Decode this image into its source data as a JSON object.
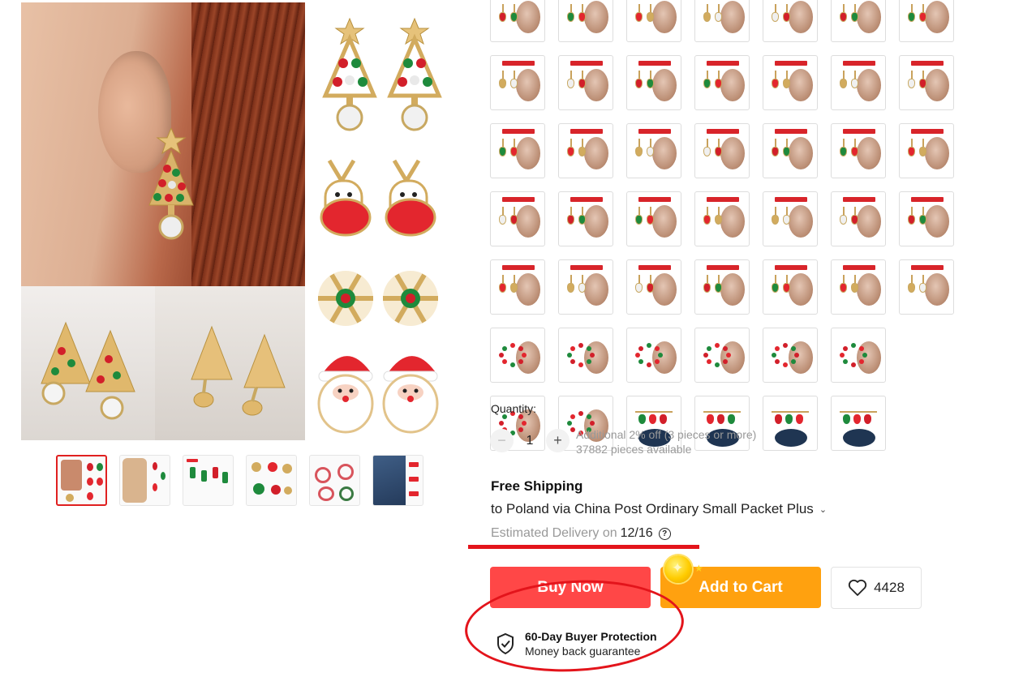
{
  "product": {
    "main_image_name": "christmas-earrings-collage",
    "thumbnails_count": 6
  },
  "quantity": {
    "label": "Quantity:",
    "minus": "−",
    "plus": "+",
    "value": "1",
    "discount_note": "Additional 2% off (3 pieces or more)",
    "available": "37882 pieces available"
  },
  "shipping": {
    "title": "Free Shipping",
    "destination": "to Poland via China Post Ordinary Small Packet Plus",
    "chevron": "⌄",
    "delivery_label": "Estimated Delivery on",
    "delivery_date": "12/16",
    "help": "?"
  },
  "actions": {
    "buy_now": "Buy Now",
    "add_to_cart": "Add to Cart",
    "wishlist_count": "4428"
  },
  "protection": {
    "title": "60-Day Buyer Protection",
    "subtitle": "Money back guarantee"
  },
  "colors": {
    "buy": "#ff4747",
    "cart": "#ffa10f",
    "annotation": "#e3141b"
  }
}
